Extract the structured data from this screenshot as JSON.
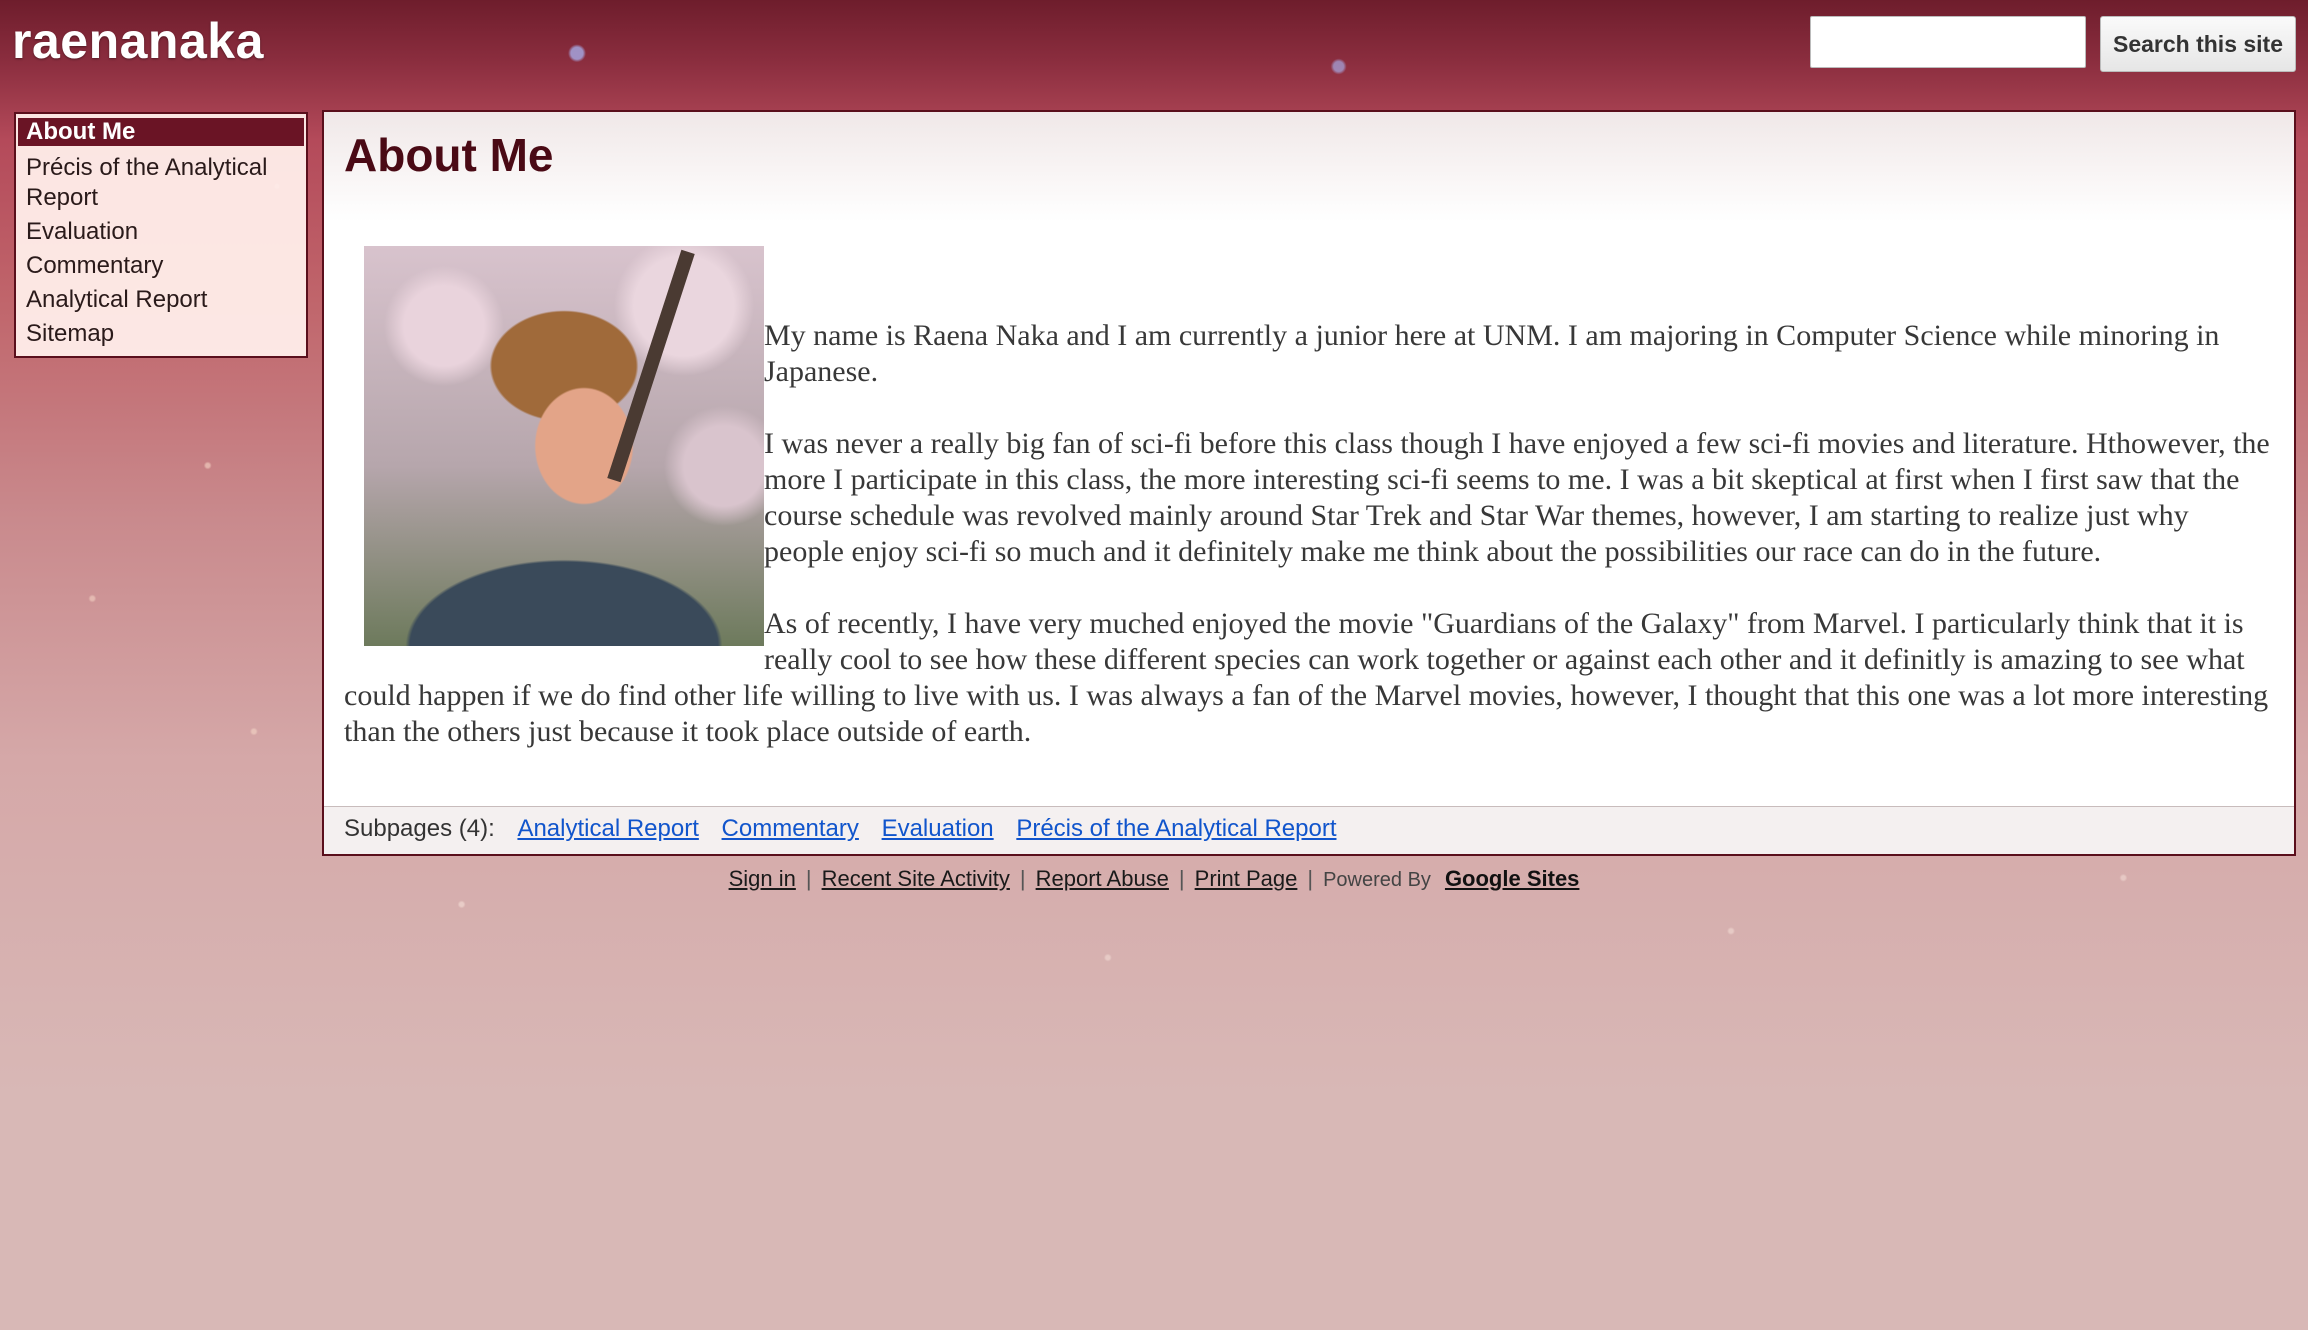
{
  "site": {
    "title": "raenanaka"
  },
  "search": {
    "placeholder": "",
    "button_label": "Search this site"
  },
  "sidebar": {
    "items": [
      {
        "label": "About Me",
        "active": true
      },
      {
        "label": "Précis of the Analytical Report",
        "active": false
      },
      {
        "label": "Evaluation",
        "active": false
      },
      {
        "label": "Commentary",
        "active": false
      },
      {
        "label": "Analytical Report",
        "active": false
      },
      {
        "label": "Sitemap",
        "active": false
      }
    ]
  },
  "main": {
    "title": "About Me",
    "paragraphs": [
      "My name is Raena Naka and I am currently a junior here at UNM. I am majoring in Computer Science while minoring in Japanese.",
      "I was never a really big fan of sci-fi before this class though I have enjoyed a few sci-fi movies and literature. Hthowever, the more I participate in this class, the more interesting sci-fi seems to me. I was a bit skeptical at first when I first saw that the course schedule was revolved mainly around Star Trek and Star War themes, however, I am starting to realize just why people enjoy sci-fi so much and it definitely make me think about the possibilities our race can do in the future.",
      "As of recently, I have very muched enjoyed the movie \"Guardians of the Galaxy\" from Marvel. I particularly think that it is really cool to see how these different species can work together or against each other and it definitly is amazing to see what could happen if we do find other life willing to live with us. I was always a fan of the Marvel movies, however, I thought that this one was a lot more interesting than the others just because it took place outside of earth."
    ],
    "subpages_label": "Subpages (4):",
    "subpages": [
      "Analytical Report",
      "Commentary",
      "Evaluation",
      "Précis of the Analytical Report"
    ]
  },
  "footer": {
    "links": [
      "Sign in",
      "Recent Site Activity",
      "Report Abuse",
      "Print Page"
    ],
    "powered_by": "Powered By",
    "brand": "Google Sites"
  },
  "colors": {
    "accent": "#6a1425",
    "border": "#5a0f1c",
    "link": "#1155cc"
  }
}
